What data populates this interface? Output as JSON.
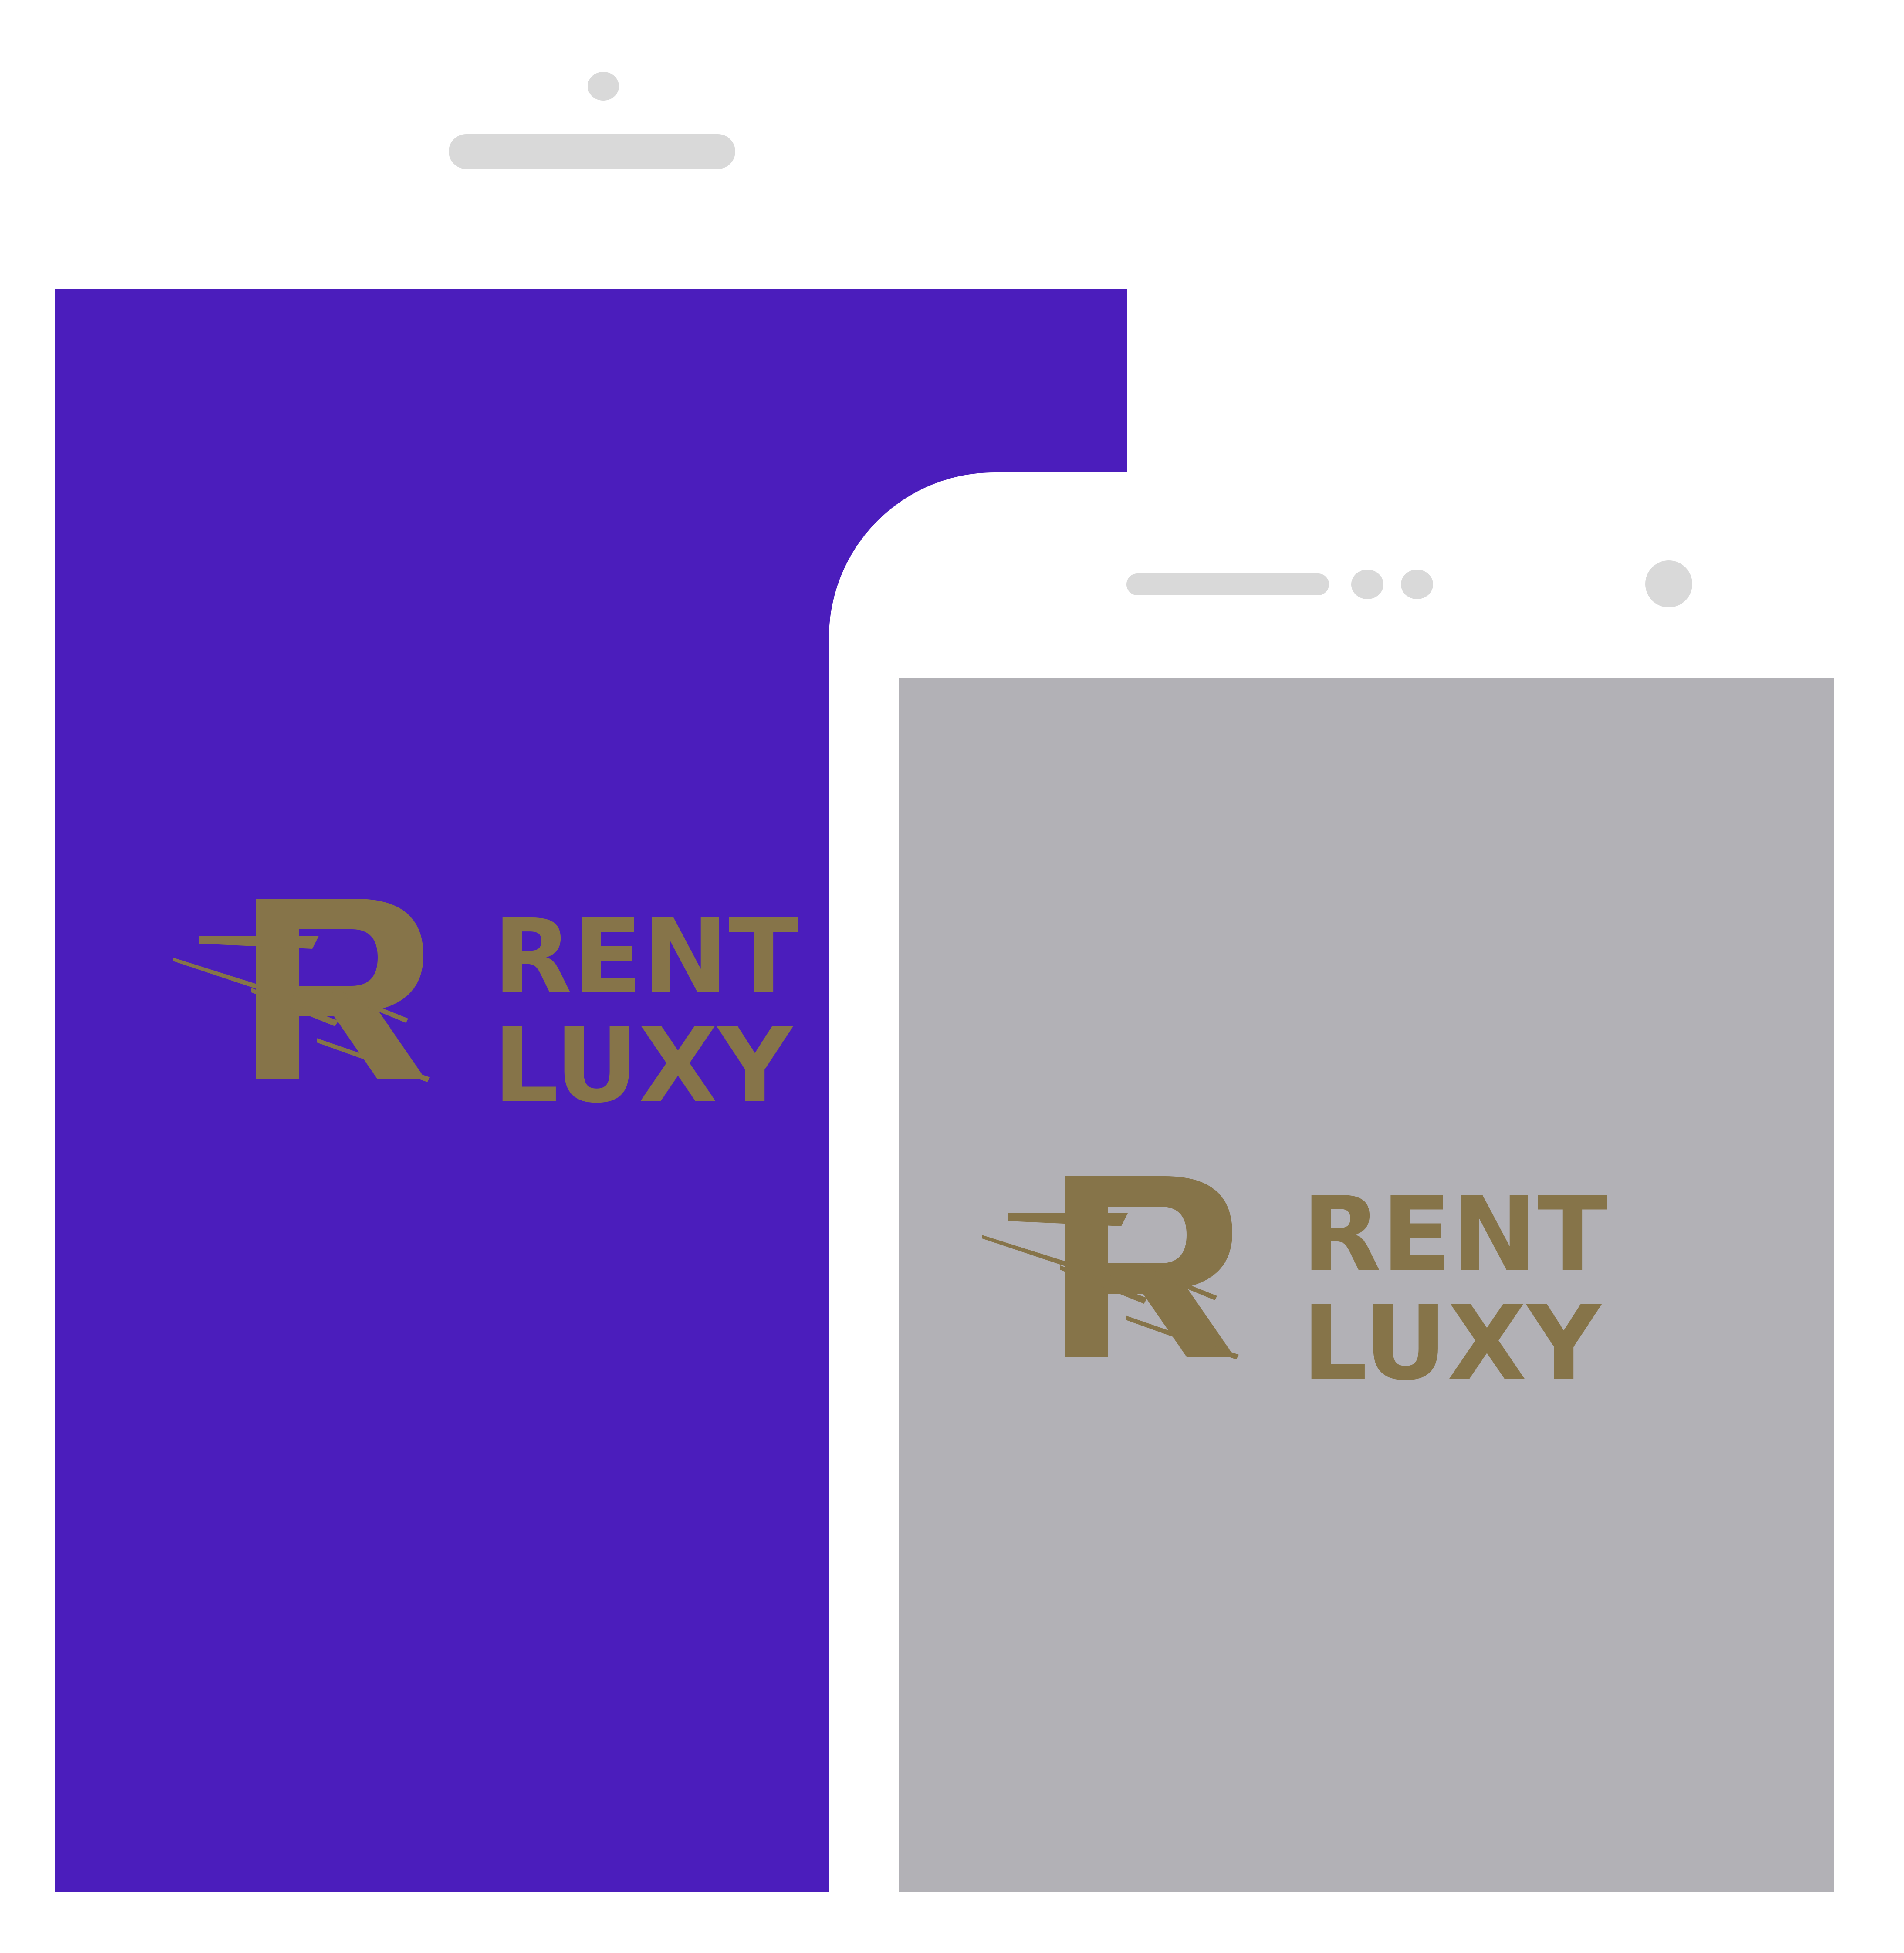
{
  "colors": {
    "back_screen": "#4b1dbc",
    "front_screen": "#b2b1b6",
    "logo_gold": "#867449",
    "device_frame": "#ffffff",
    "device_detail": "#d9d9d9"
  },
  "screens": {
    "back": {
      "logo": {
        "line1": "RENT",
        "line2": "LUXY"
      }
    },
    "front": {
      "logo": {
        "line1": "RENT",
        "line2": "LUXY"
      }
    }
  }
}
